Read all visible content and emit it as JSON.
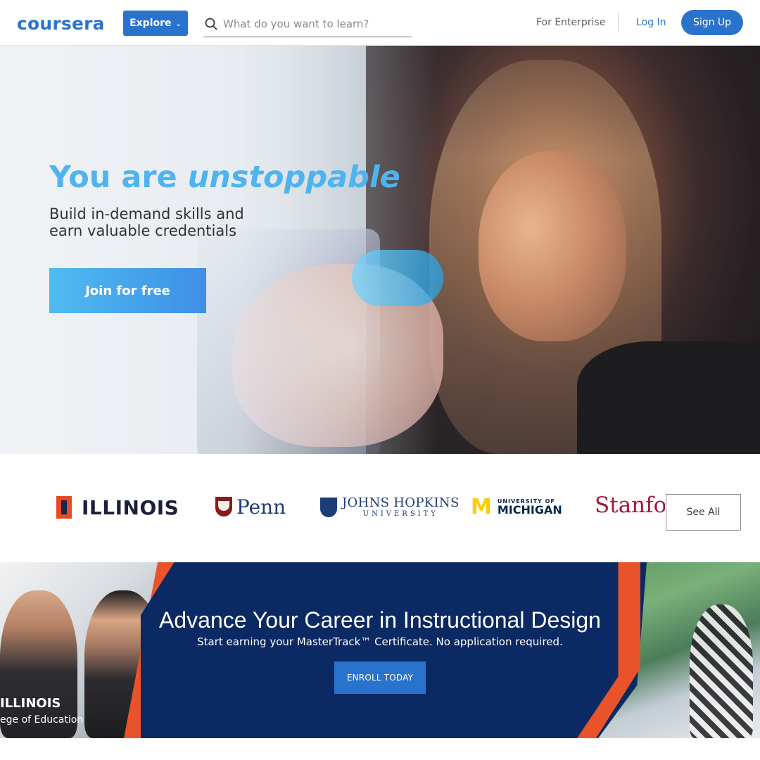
{
  "header": {
    "logo_text": "coursera",
    "explore_label": "Explore",
    "search_placeholder": "What do you want to learn?",
    "enterprise_label": "For Enterprise",
    "login_label": "Log In",
    "signup_label": "Sign Up"
  },
  "hero": {
    "title_prefix": "You are ",
    "title_emphasis": "unstoppable",
    "subtitle_line1": "Build in-demand skills and",
    "subtitle_line2": "earn valuable credentials",
    "cta_label": "Join for free"
  },
  "partners": {
    "items": [
      {
        "name": "ILLINOIS"
      },
      {
        "name": "Penn"
      },
      {
        "name_line1": "JOHNS HOPKINS",
        "name_line2": "UNIVERSITY"
      },
      {
        "name_line1": "UNIVERSITY OF",
        "name_line2": "MICHIGAN"
      },
      {
        "name": "Stanford"
      }
    ],
    "see_all_label": "See All"
  },
  "banner": {
    "title": "Advance Your Career in Instructional Design",
    "subtitle": "Start earning your MasterTrack™ Certificate. No application required.",
    "cta_label": "ENROLL TODAY",
    "school_line1": "ILLINOIS",
    "school_line2": "ege of Education"
  },
  "colors": {
    "brand_blue": "#2a73cc",
    "hero_title": "#4fb4ee",
    "banner_navy": "#0b2962",
    "banner_orange": "#e9532b"
  }
}
